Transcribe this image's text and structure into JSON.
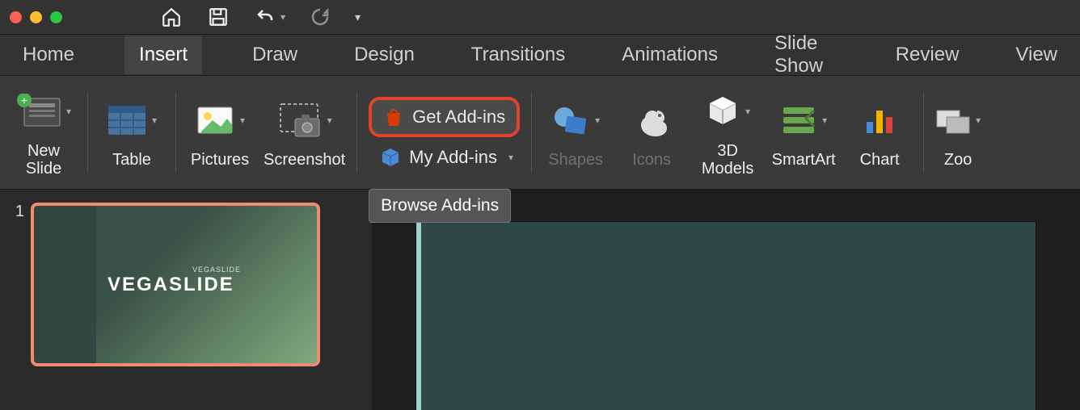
{
  "menu": {
    "home": "Home",
    "insert": "Insert",
    "draw": "Draw",
    "design": "Design",
    "transitions": "Transitions",
    "animations": "Animations",
    "slideshow": "Slide Show",
    "review": "Review",
    "view": "View"
  },
  "ribbon": {
    "new_slide": "New\nSlide",
    "table": "Table",
    "pictures": "Pictures",
    "screenshot": "Screenshot",
    "get_addins": "Get Add-ins",
    "my_addins": "My Add-ins",
    "shapes": "Shapes",
    "icons": "Icons",
    "models3d": "3D\nModels",
    "smartart": "SmartArt",
    "chart": "Chart",
    "zoom": "Zoo"
  },
  "tooltip": {
    "browse": "Browse Add-ins"
  },
  "slide": {
    "number": "1",
    "title": "VEGASLIDE",
    "subtitle": "VEGASLIDE"
  }
}
